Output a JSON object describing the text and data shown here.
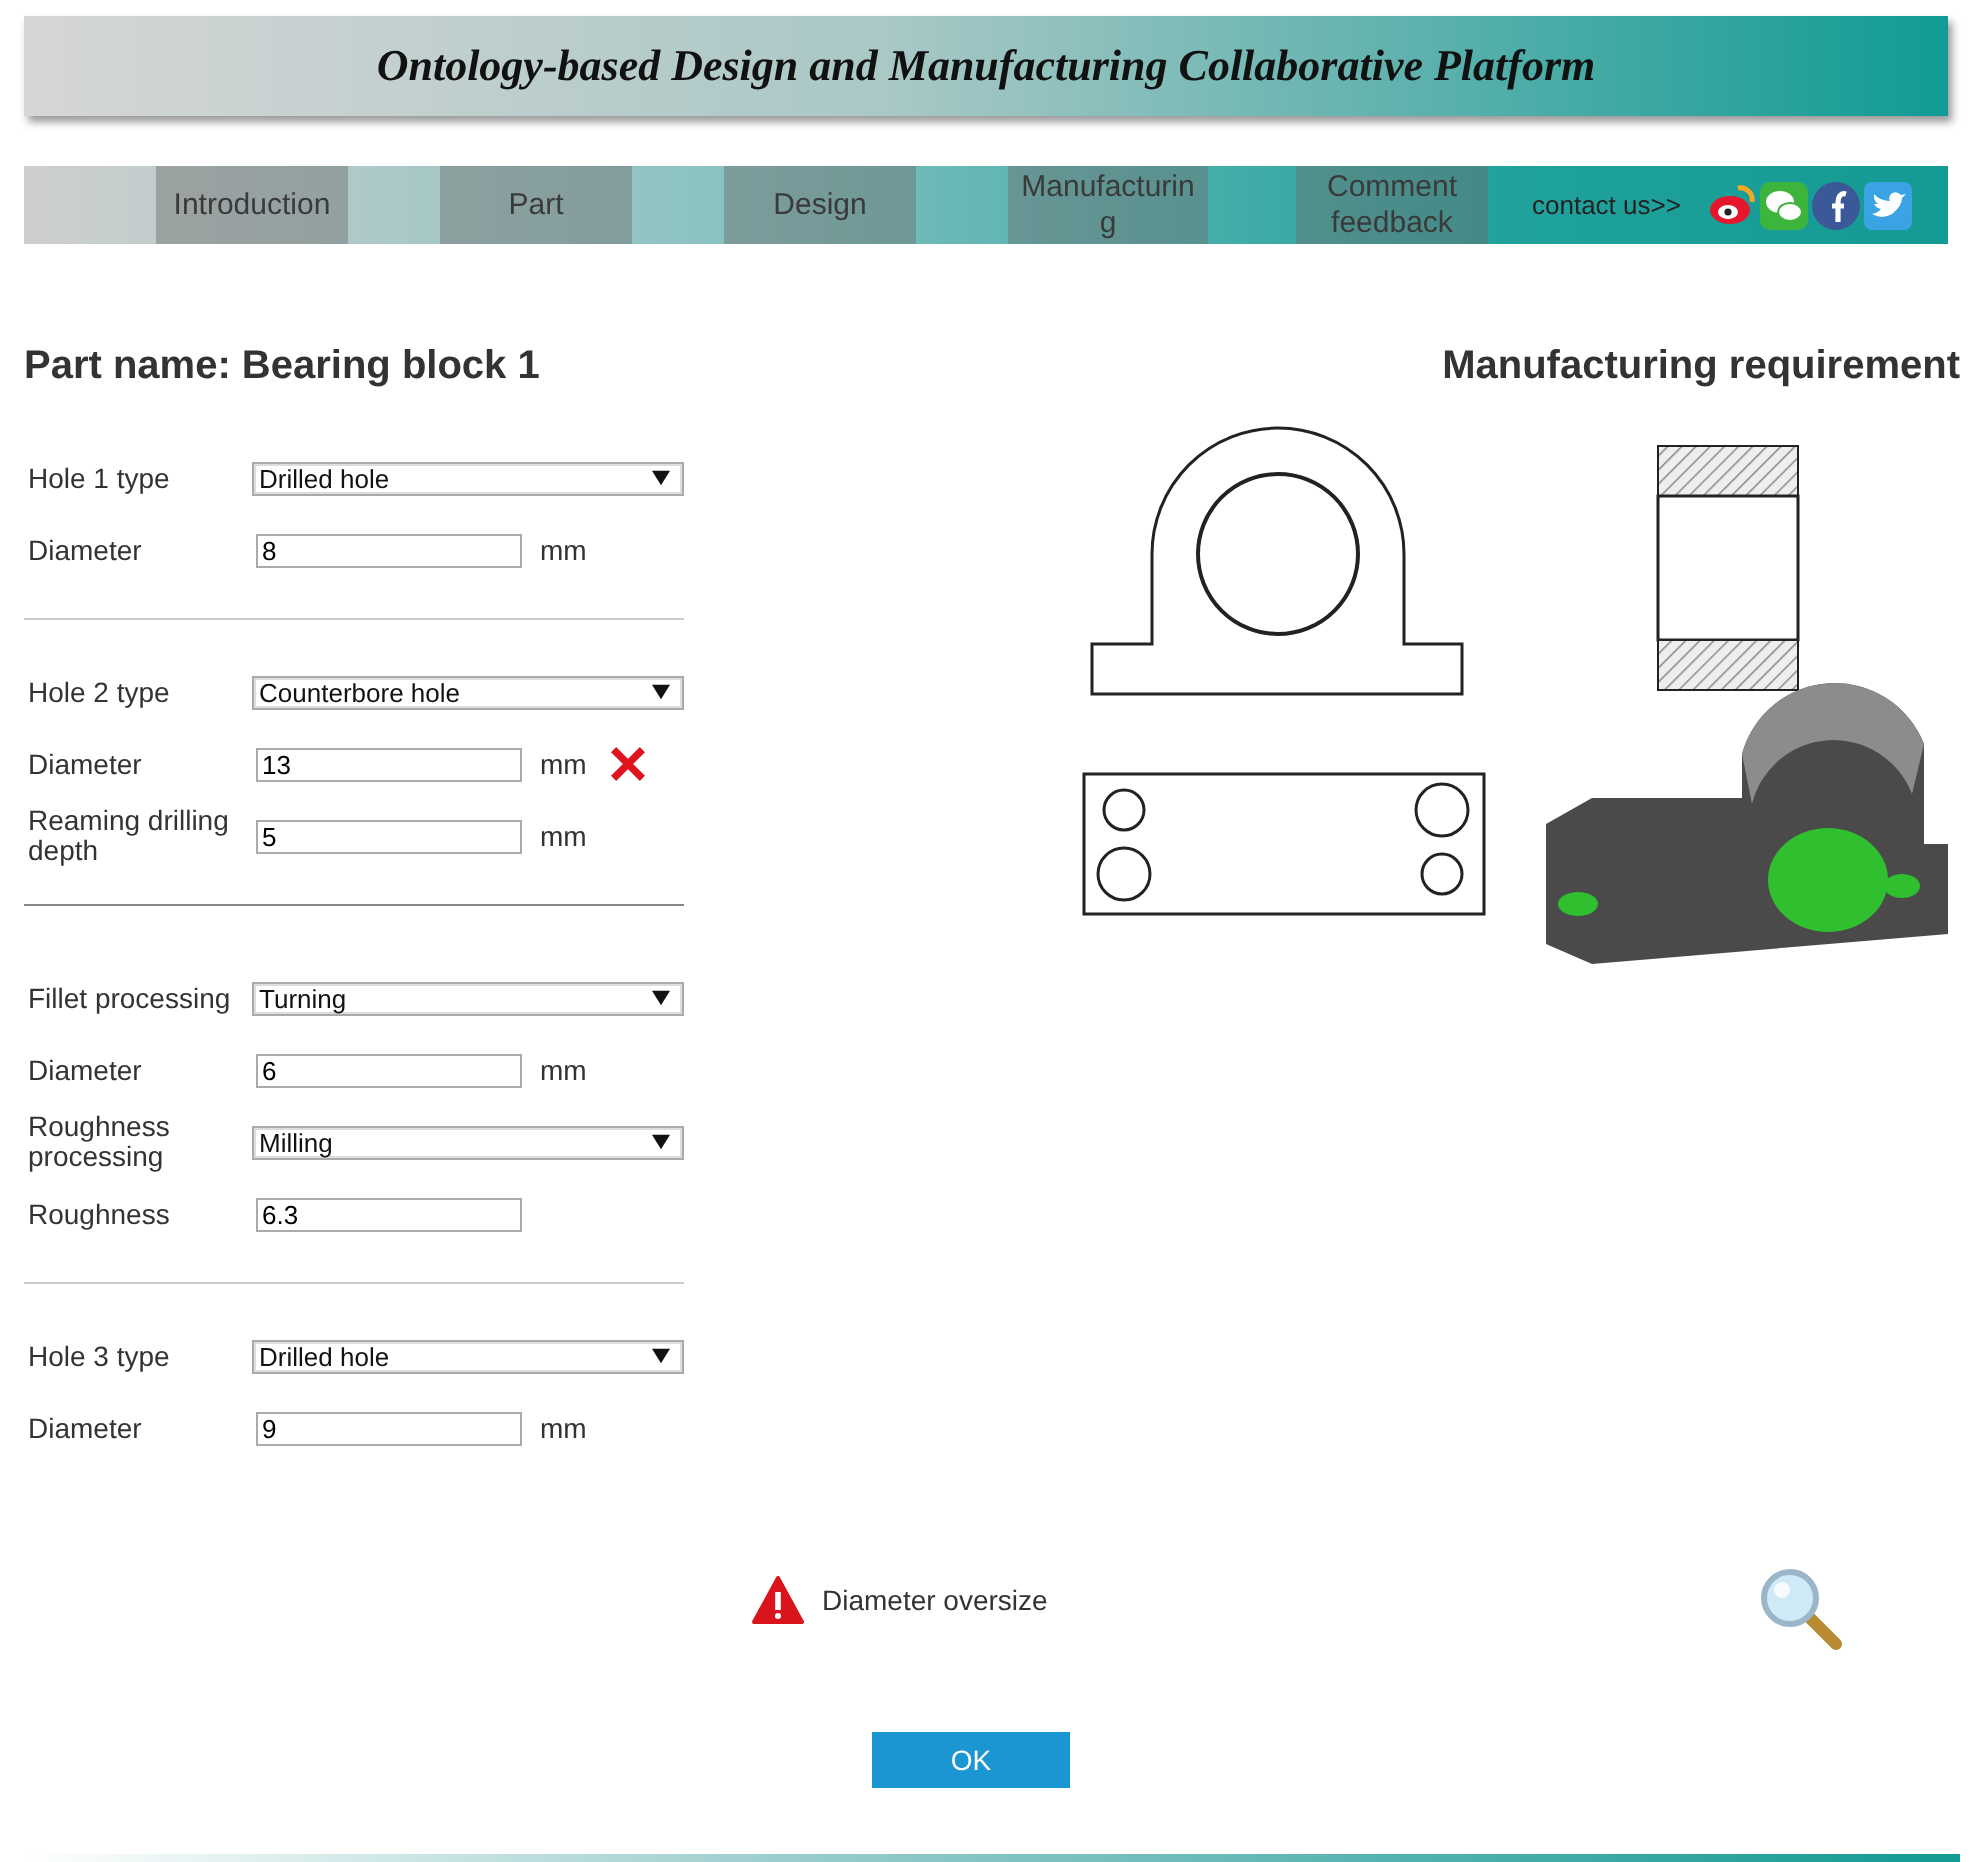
{
  "header": {
    "title": "Ontology-based Design and Manufacturing Collaborative Platform"
  },
  "nav": {
    "items": [
      {
        "label": "Introduction"
      },
      {
        "label": "Part"
      },
      {
        "label": "Design"
      },
      {
        "label": "Manufacturing"
      },
      {
        "label": "Comment feedback"
      }
    ],
    "contact": "contact us>>"
  },
  "part_heading": "Part name: Bearing block 1",
  "requirement_heading": "Manufacturing requirement",
  "sections": [
    {
      "fields": [
        {
          "kind": "select",
          "label": "Hole 1 type",
          "value": "Drilled hole"
        },
        {
          "kind": "input",
          "label": "Diameter",
          "value": "8",
          "unit": "mm",
          "error": false
        }
      ]
    },
    {
      "fields": [
        {
          "kind": "select",
          "label": "Hole 2 type",
          "value": "Counterbore hole"
        },
        {
          "kind": "input",
          "label": "Diameter",
          "value": "13",
          "unit": "mm",
          "error": true
        },
        {
          "kind": "input",
          "label": "Reaming drilling depth",
          "value": "5",
          "unit": "mm",
          "error": false
        }
      ]
    },
    {
      "fields": [
        {
          "kind": "select",
          "label": "Fillet processing",
          "value": "Turning"
        },
        {
          "kind": "input",
          "label": "Diameter",
          "value": "6",
          "unit": "mm",
          "error": false
        },
        {
          "kind": "select",
          "label": "Roughness processing",
          "value": "Milling"
        },
        {
          "kind": "input",
          "label": "Roughness",
          "value": "6.3",
          "error": false
        }
      ]
    },
    {
      "fields": [
        {
          "kind": "select",
          "label": "Hole 3 type",
          "value": "Drilled hole"
        },
        {
          "kind": "input",
          "label": "Diameter",
          "value": "9",
          "unit": "mm",
          "error": false
        }
      ]
    }
  ],
  "message": {
    "kind": "warning",
    "text": "Diameter oversize"
  },
  "ok_button": "OK"
}
